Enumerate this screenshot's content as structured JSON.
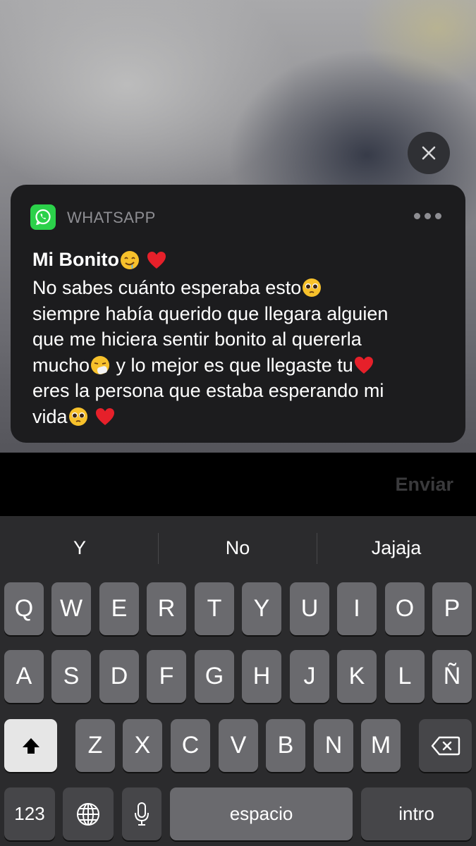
{
  "notification": {
    "app_name": "WHATSAPP",
    "sender": "Mi Bonito",
    "message_lines": [
      "No sabes cuánto esperaba esto",
      "siempre había querido que llegara alguien",
      "que me hiciera sentir bonito al quererla",
      "mucho",
      " y lo mejor es que llegaste tu",
      "eres la persona que estaba esperando mi",
      "vida"
    ]
  },
  "reply": {
    "send_label": "Enviar"
  },
  "keyboard": {
    "suggestions": [
      "Y",
      "No",
      "Jajaja"
    ],
    "row1": [
      "Q",
      "W",
      "E",
      "R",
      "T",
      "Y",
      "U",
      "I",
      "O",
      "P"
    ],
    "row2": [
      "A",
      "S",
      "D",
      "F",
      "G",
      "H",
      "J",
      "K",
      "L",
      "Ñ"
    ],
    "row3": [
      "Z",
      "X",
      "C",
      "V",
      "B",
      "N",
      "M"
    ],
    "numbers_label": "123",
    "space_label": "espacio",
    "return_label": "intro"
  },
  "colors": {
    "whatsapp_green": "#2bd14a",
    "heart_red": "#e6202a"
  }
}
